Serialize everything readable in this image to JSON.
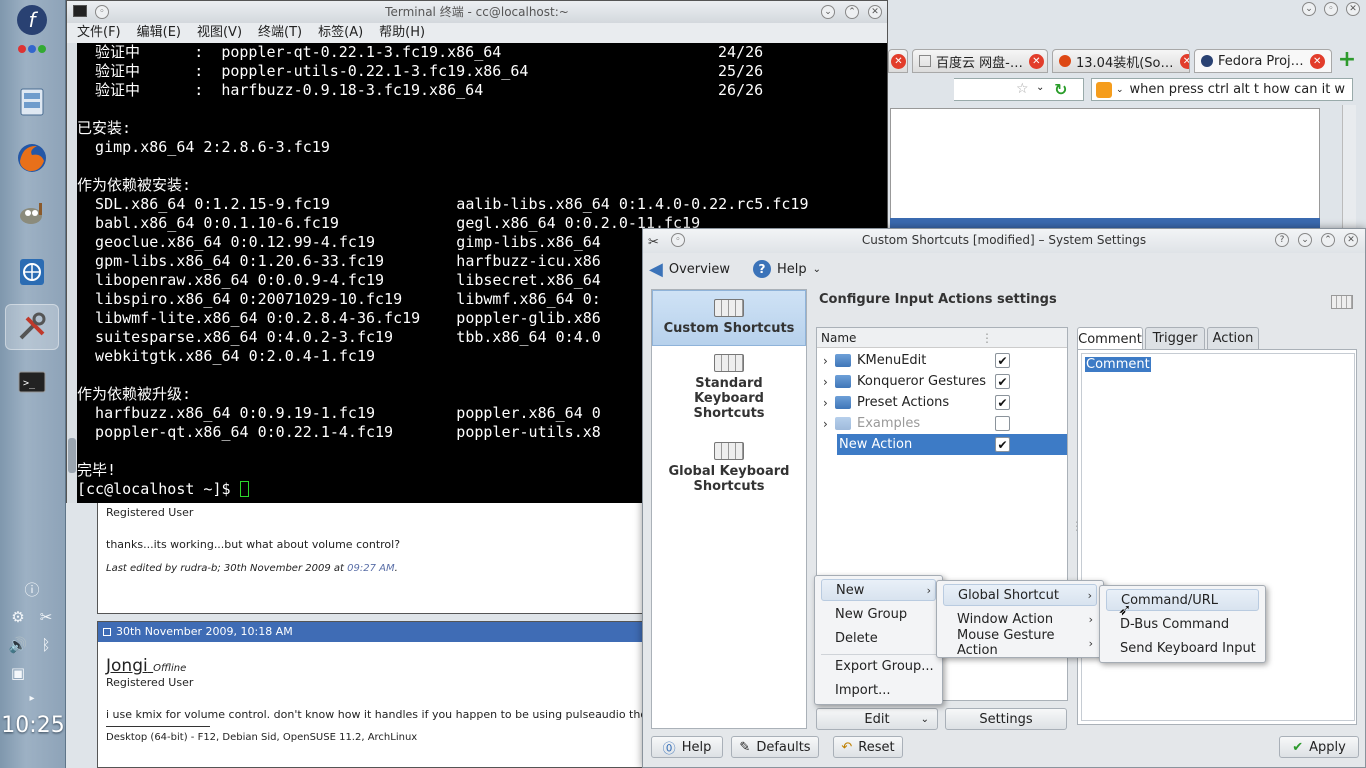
{
  "panel": {
    "clock": "10:25"
  },
  "firefox": {
    "tabs": [
      {
        "label": "百度云 网盘-…"
      },
      {
        "label": "13.04装机(So…"
      },
      {
        "label": "Fedora Proj…"
      }
    ],
    "search_value": "when press ctrl alt t how can it w",
    "posts": {
      "post1_role": "Registered User",
      "post1_body": "thanks...its working...but what about volume control?",
      "post1_edit": "Last edited by rudra-b; 30th November 2009 at",
      "post1_time": "09:27 AM",
      "post1_dot": ".",
      "post2_header": "30th November 2009, 10:18 AM",
      "post2_user": "Jongi",
      "post2_status": "Offline",
      "post2_role": "Registered User",
      "post2_body": "i use kmix for volume control. don't know how it handles if you happen to be using pulseaudio though.",
      "post2_sig": "Desktop (64-bit) - F12, Debian Sid, OpenSUSE 11.2, ArchLinux"
    }
  },
  "terminal": {
    "title": "Terminal 终端 - cc@localhost:~",
    "menu": [
      "文件(F)",
      "编辑(E)",
      "视图(V)",
      "终端(T)",
      "标签(A)",
      "帮助(H)"
    ],
    "lines": [
      "  验证中      :  poppler-qt-0.22.1-3.fc19.x86_64                        24/26",
      "  验证中      :  poppler-utils-0.22.1-3.fc19.x86_64                     25/26",
      "  验证中      :  harfbuzz-0.9.18-3.fc19.x86_64                          26/26",
      "",
      "已安装:",
      "  gimp.x86_64 2:2.8.6-3.fc19",
      "",
      "作为依赖被安装:",
      "  SDL.x86_64 0:1.2.15-9.fc19              aalib-libs.x86_64 0:1.4.0-0.22.rc5.fc19",
      "  babl.x86_64 0:0.1.10-6.fc19             gegl.x86_64 0:0.2.0-11.fc19",
      "  geoclue.x86_64 0:0.12.99-4.fc19         gimp-libs.x86_64",
      "  gpm-libs.x86_64 0:1.20.6-33.fc19        harfbuzz-icu.x86",
      "  libopenraw.x86_64 0:0.0.9-4.fc19        libsecret.x86_64",
      "  libspiro.x86_64 0:20071029-10.fc19      libwmf.x86_64 0:",
      "  libwmf-lite.x86_64 0:0.2.8.4-36.fc19    poppler-glib.x86",
      "  suitesparse.x86_64 0:4.0.2-3.fc19       tbb.x86_64 0:4.0",
      "  webkitgtk.x86_64 0:2.0.4-1.fc19",
      "",
      "作为依赖被升级:",
      "  harfbuzz.x86_64 0:0.9.19-1.fc19         poppler.x86_64 0",
      "  poppler-qt.x86_64 0:0.22.1-4.fc19       poppler-utils.x8",
      "",
      "完毕!"
    ],
    "prompt": "[cc@localhost ~]$ "
  },
  "settings": {
    "title": "Custom Shortcuts [modified] – System Settings",
    "overview": "Overview",
    "help": "Help",
    "nav": [
      "Custom Shortcuts",
      "Standard Keyboard Shortcuts",
      "Global Keyboard Shortcuts"
    ],
    "heading": "Configure Input Actions settings",
    "tree_header": "Name",
    "tree": [
      {
        "name": "KMenuEdit",
        "checked": true
      },
      {
        "name": "Konqueror Gestures",
        "checked": true
      },
      {
        "name": "Preset Actions",
        "checked": true
      },
      {
        "name": "Examples",
        "checked": false
      },
      {
        "name": "New Action",
        "checked": true
      }
    ],
    "tabs": [
      "Comment",
      "Trigger",
      "Action"
    ],
    "comment_text": "Comment",
    "edit_btn": "Edit",
    "settings_btn": "Settings",
    "help_btn": "Help",
    "defaults_btn": "Defaults",
    "reset_btn": "Reset",
    "apply_btn": "Apply",
    "menu1": [
      "New",
      "New Group",
      "Delete",
      "Export Group...",
      "Import..."
    ],
    "menu2": [
      "Global Shortcut",
      "Window Action",
      "Mouse Gesture Action"
    ],
    "menu3": [
      "Command/URL",
      "D-Bus Command",
      "Send Keyboard Input"
    ]
  }
}
